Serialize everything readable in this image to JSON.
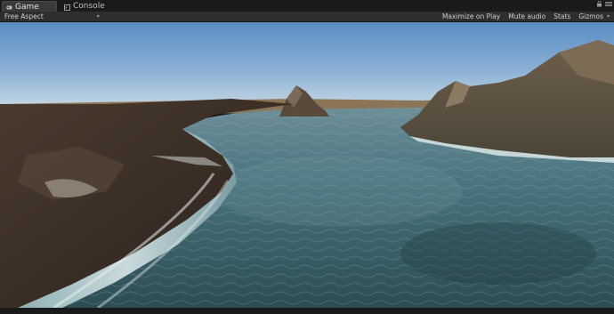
{
  "tabs": [
    {
      "label": "Game",
      "icon": "gamepad-icon",
      "active": true
    },
    {
      "label": "Console",
      "icon": "console-icon",
      "active": false
    }
  ],
  "toolbar": {
    "aspect_label": "Free Aspect",
    "maximize_label": "Maximize on Play",
    "mute_label": "Mute audio",
    "stats_label": "Stats",
    "gizmos_label": "Gizmos"
  },
  "colors": {
    "panel_bg": "#2e2e2e",
    "tab_bg": "#3a3a3a",
    "sky_top": "#5a8cc4",
    "sky_bottom": "#b6cfe2",
    "water": "#3d6570",
    "terrain": "#3b3027"
  }
}
